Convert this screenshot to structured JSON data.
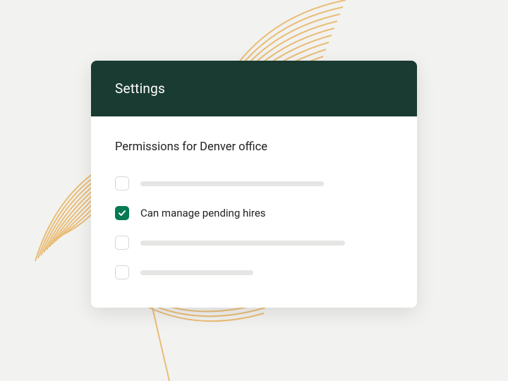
{
  "card": {
    "header_title": "Settings",
    "section_title": "Permissions for Denver office",
    "permissions": [
      {
        "checked": false,
        "label": null,
        "placeholder_width": 260
      },
      {
        "checked": true,
        "label": "Can manage pending hires",
        "placeholder_width": null
      },
      {
        "checked": false,
        "label": null,
        "placeholder_width": 290
      },
      {
        "checked": false,
        "label": null,
        "placeholder_width": 160
      }
    ]
  },
  "colors": {
    "header_bg": "#1a3b31",
    "accent": "#067a52",
    "leaf": "#e9b86a"
  }
}
